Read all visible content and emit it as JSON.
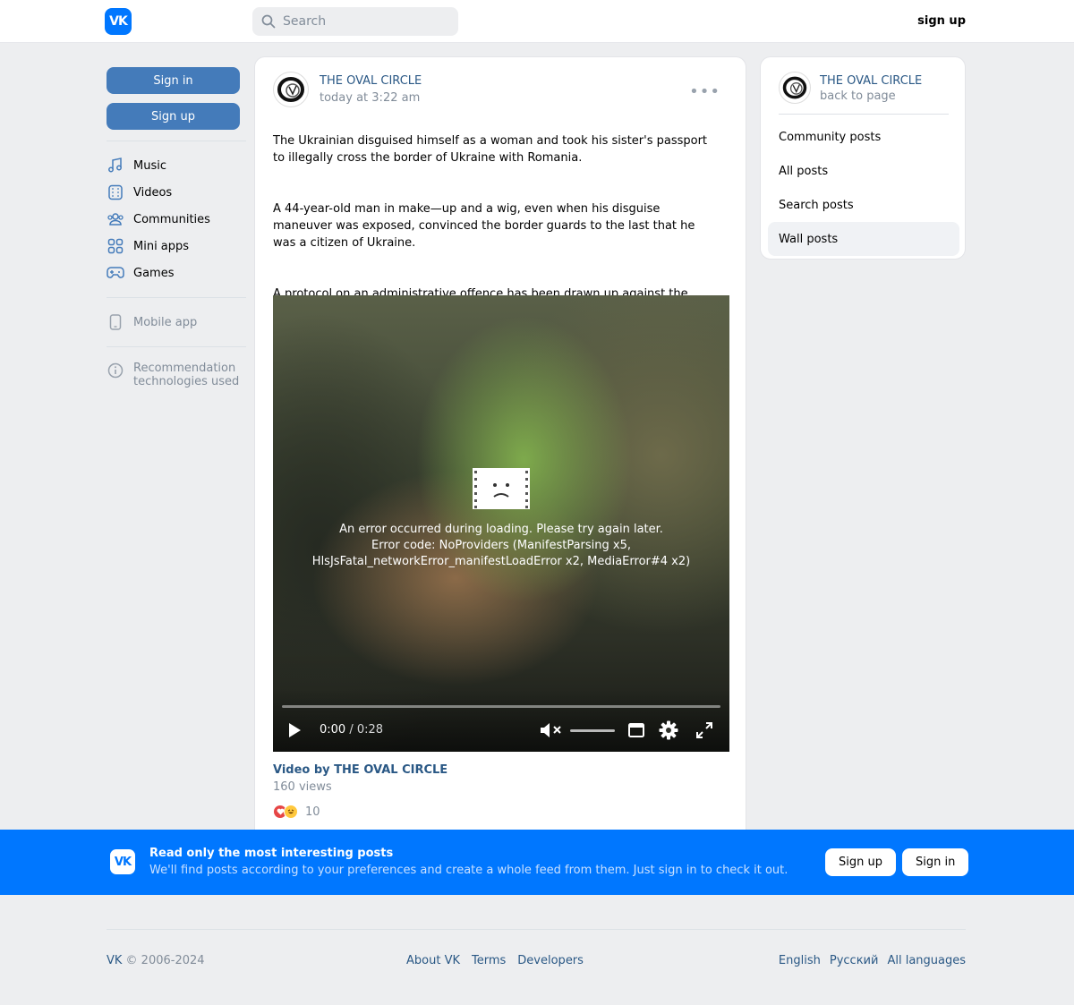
{
  "header": {
    "logo_text": "VK",
    "search_placeholder": "Search",
    "signup_label": "sign up"
  },
  "leftnav": {
    "signin_label": "Sign in",
    "signup_label": "Sign up",
    "items": [
      {
        "label": "Music",
        "icon": "music-icon"
      },
      {
        "label": "Videos",
        "icon": "video-icon"
      },
      {
        "label": "Communities",
        "icon": "communities-icon"
      },
      {
        "label": "Mini apps",
        "icon": "mini-apps-icon"
      },
      {
        "label": "Games",
        "icon": "gamepad-icon"
      }
    ],
    "mobile_app_label": "Mobile app",
    "recommendation_label": "Recommendation technologies used"
  },
  "post": {
    "author": "THE OVAL CIRCLE",
    "time": "today at 3:22 am",
    "paragraphs": [
      "The Ukrainian disguised himself as a woman and took his sister's passport to illegally cross the border of Ukraine with Romania.",
      "A 44-year-old man in make—up and a wig, even when his disguise maneuver was exposed, convinced the border guards to the last that he was a citizen of Ukraine.",
      "A protocol on an administrative offence has been drawn up against the violator, the case will be considered by the court..... This just proves that the majority of the people in Ukraine don't want to fight, they are being forced to go die as cannon fodder."
    ],
    "video": {
      "error_line1": "An error occurred during loading. Please try again later.",
      "error_line2": "Error code: NoProviders (ManifestParsing x5,",
      "error_line3": "HlsJsFatal_networkError_manifestLoadError x2, MediaError#4 x2)",
      "current_time": "0:00",
      "separator": " / ",
      "duration": "0:28",
      "title": "Video by THE OVAL CIRCLE",
      "views": "160 views"
    },
    "reactions_count": "10"
  },
  "right_panel": {
    "name": "THE OVAL CIRCLE",
    "back_label": "back to page",
    "items": [
      "Community posts",
      "All posts",
      "Search posts",
      "Wall posts"
    ],
    "active_item": "Wall posts"
  },
  "banner": {
    "logo_text": "VK",
    "title": "Read only the most interesting posts",
    "subtitle": "We'll find posts according to your preferences and create a whole feed from them. Just sign in to check it out.",
    "signup_label": "Sign up",
    "signin_label": "Sign in"
  },
  "footer": {
    "brand": "VK",
    "copyright": " © 2006-2024",
    "links": [
      "About VK",
      "Terms",
      "Developers"
    ],
    "languages": [
      "English",
      "Русский",
      "All languages"
    ]
  },
  "colors": {
    "brand_blue": "#0077ff",
    "button_blue": "#447bba",
    "link_blue": "#2a5885",
    "muted_gray": "#818c99",
    "page_bg": "#edeef0"
  }
}
